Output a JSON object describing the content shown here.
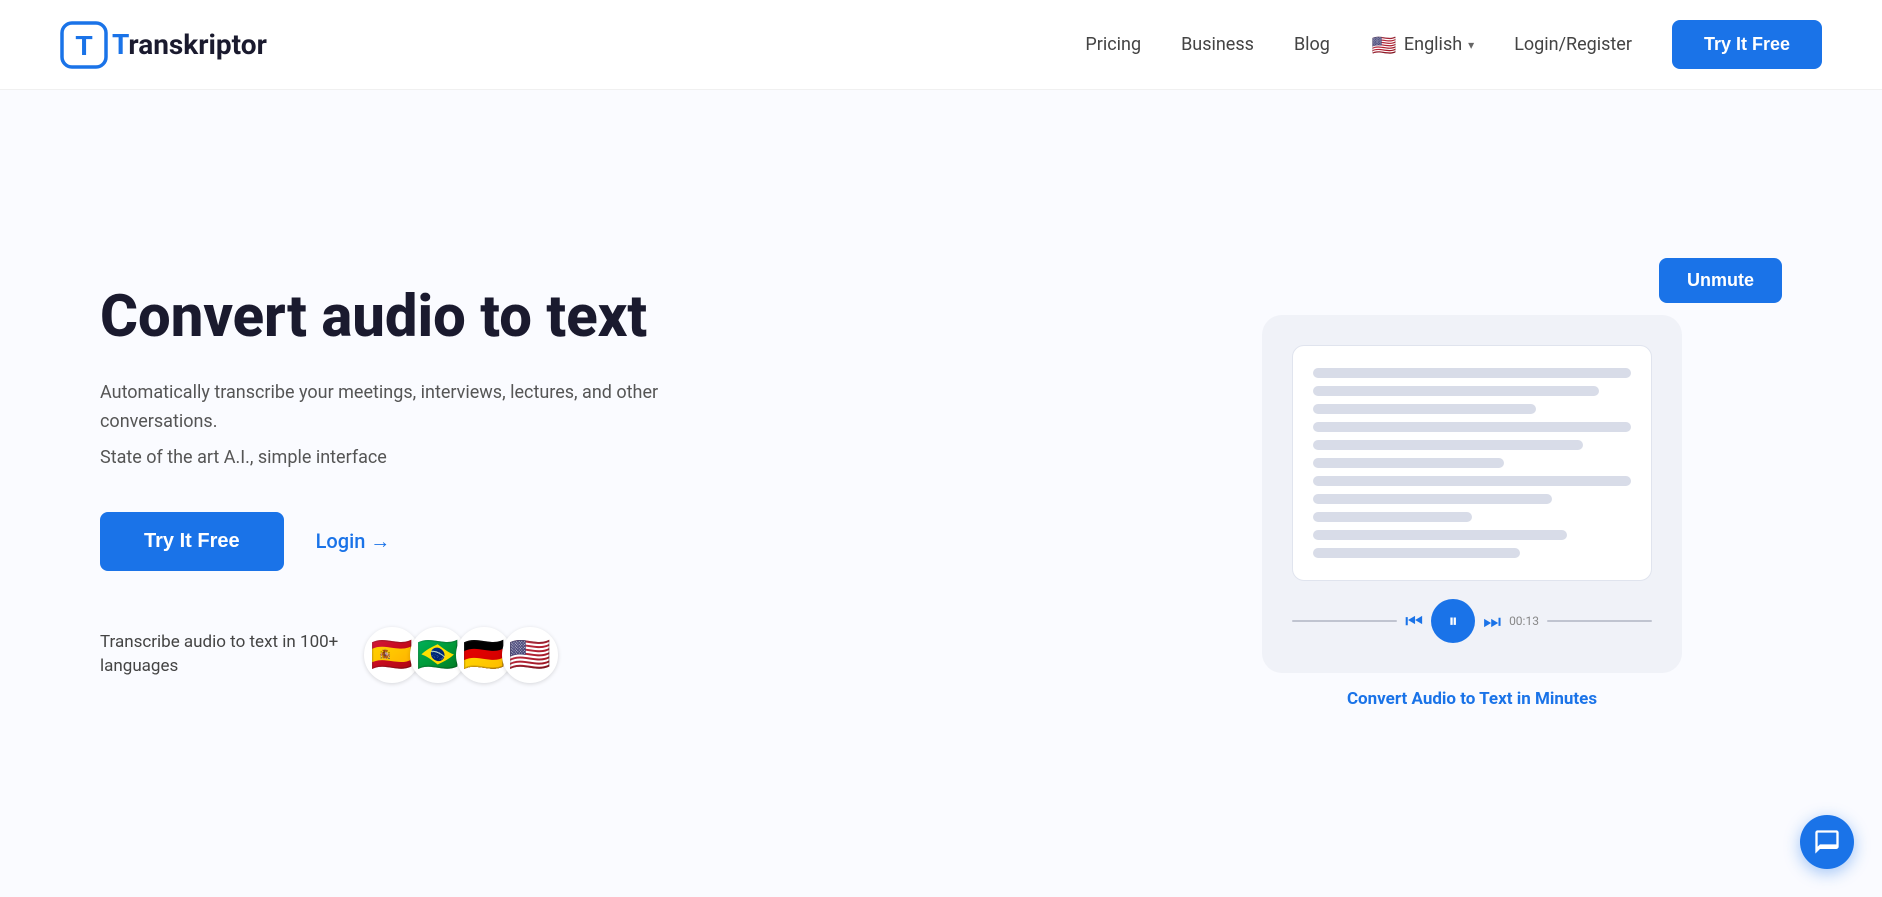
{
  "navbar": {
    "logo_letter": "T",
    "logo_name": "ranskriptor",
    "nav_pricing": "Pricing",
    "nav_business": "Business",
    "nav_blog": "Blog",
    "nav_language": "English",
    "nav_login": "Login/Register",
    "nav_try_free": "Try It Free",
    "flag_emoji": "🇺🇸"
  },
  "hero": {
    "title": "Convert audio to text",
    "subtitle": "Automatically transcribe your meetings, interviews, lectures, and other conversations.",
    "tagline": "State of the art A.I., simple interface",
    "cta_try": "Try It Free",
    "cta_login": "Login →",
    "lang_label": "Transcribe audio to text in 100+ languages",
    "flags": [
      "🇪🇸",
      "🇧🇷",
      "🇩🇪",
      "🇺🇸"
    ],
    "unmute_label": "Unmute",
    "convert_caption": "Convert Audio to Text in Minutes",
    "text_lines": [
      "full",
      "w90",
      "w70",
      "full",
      "w85",
      "w60",
      "full",
      "w75",
      "w50",
      "w80",
      "w65"
    ]
  },
  "chat": {
    "label": "chat-bubble"
  }
}
